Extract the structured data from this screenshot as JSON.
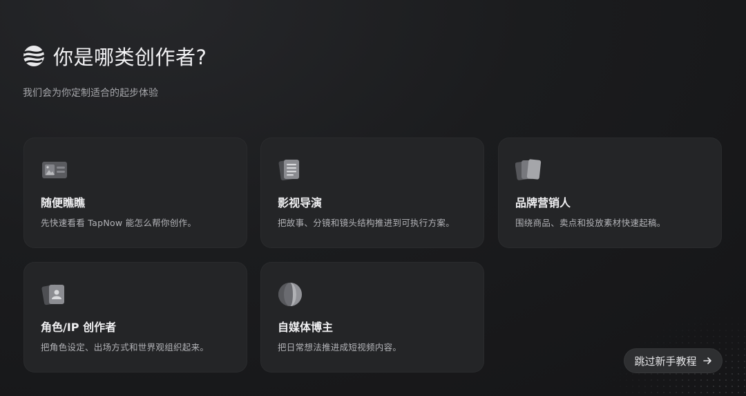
{
  "header": {
    "title": "你是哪类创作者?",
    "subtitle": "我们会为你定制适合的起步体验"
  },
  "cards": [
    {
      "title": "随便瞧瞧",
      "desc": "先快速看看 TapNow 能怎么帮你创作。",
      "icon": "image-card-icon"
    },
    {
      "title": "影视导演",
      "desc": "把故事、分镜和镜头结构推进到可执行方案。",
      "icon": "script-document-icon"
    },
    {
      "title": "品牌营销人",
      "desc": "围绕商品、卖点和投放素材快速起稿。",
      "icon": "stacked-cards-icon"
    },
    {
      "title": "角色/IP 创作者",
      "desc": "把角色设定、出场方式和世界观组织起来。",
      "icon": "character-profile-icon"
    },
    {
      "title": "自媒体博主",
      "desc": "把日常想法推进成短视频内容。",
      "icon": "sphere-icon"
    }
  ],
  "skip": {
    "label": "跳过新手教程",
    "icon": "arrow-right-icon"
  }
}
